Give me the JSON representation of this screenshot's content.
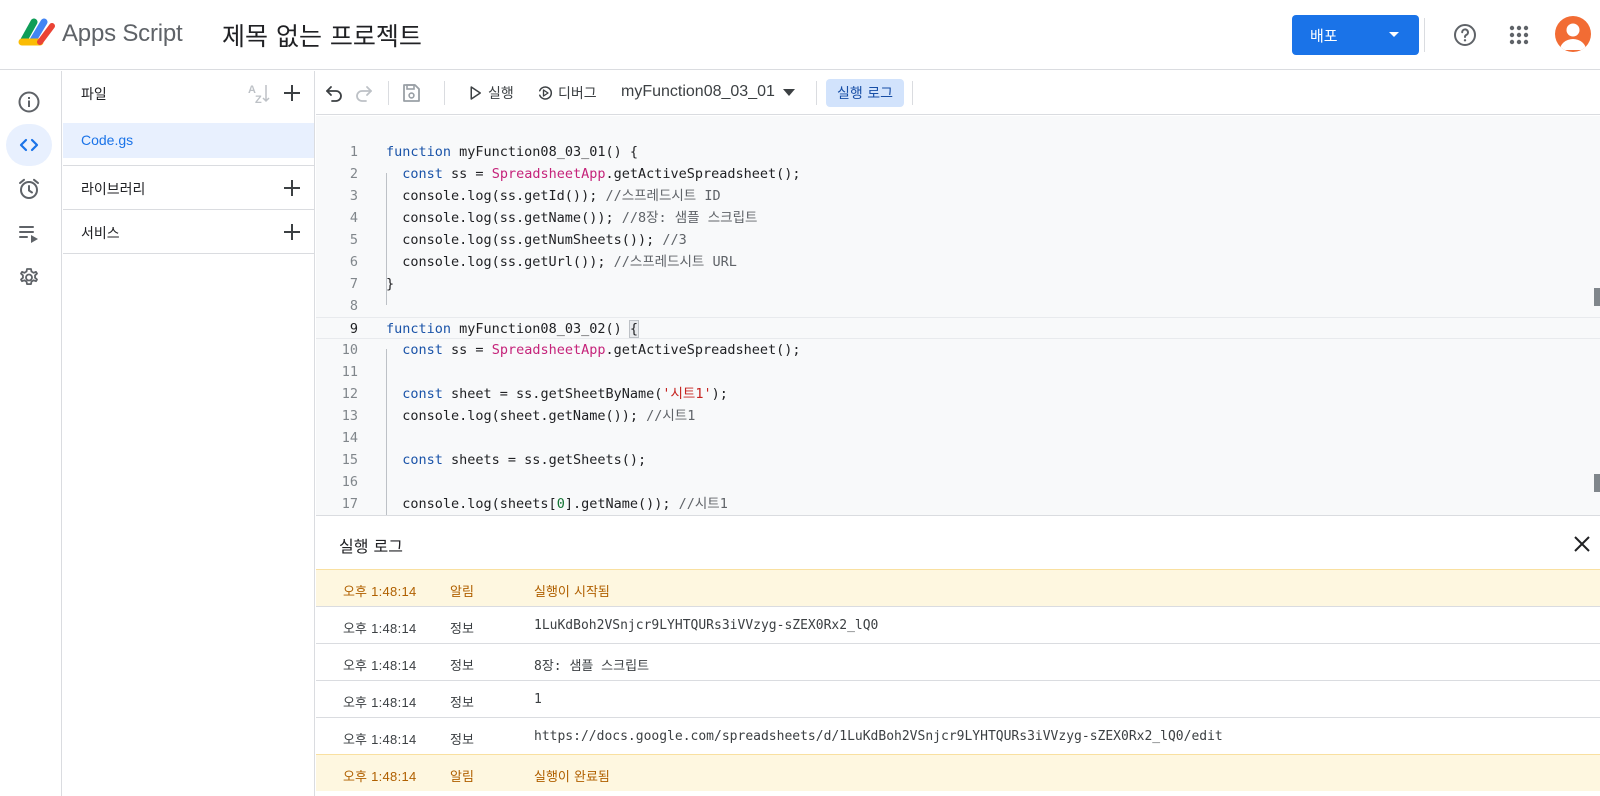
{
  "header": {
    "app_name": "Apps Script",
    "project_title": "제목 없는 프로젝트",
    "deploy_label": "배포",
    "avatar_color": "#f26c34",
    "accent": "#1a73e8"
  },
  "rail": {
    "items": [
      {
        "icon": "info-icon"
      },
      {
        "icon": "code-icon",
        "active": true
      },
      {
        "icon": "alarm-icon"
      },
      {
        "icon": "executions-icon"
      },
      {
        "icon": "gear-icon"
      }
    ]
  },
  "files_panel": {
    "files_label": "파일",
    "files": [
      "Code.gs"
    ],
    "libraries_label": "라이브러리",
    "services_label": "서비스"
  },
  "toolbar": {
    "run_label": "실행",
    "debug_label": "디버그",
    "function_selected": "myFunction08_03_01",
    "log_toggle_label": "실행 로그"
  },
  "editor": {
    "current_line": 9,
    "lines": [
      [
        {
          "t": "function",
          "c": "kw"
        },
        {
          "t": " myFunction08_03_01() {",
          "c": "p"
        }
      ],
      [
        {
          "t": "  ",
          "c": "p"
        },
        {
          "t": "const",
          "c": "kw"
        },
        {
          "t": " ss = ",
          "c": "p"
        },
        {
          "t": "SpreadsheetApp",
          "c": "cls"
        },
        {
          "t": ".getActiveSpreadsheet();",
          "c": "p"
        }
      ],
      [
        {
          "t": "  console.log(ss.getId()); ",
          "c": "p"
        },
        {
          "t": "//스프레드시트 ID",
          "c": "cm"
        }
      ],
      [
        {
          "t": "  console.log(ss.getName()); ",
          "c": "p"
        },
        {
          "t": "//8장: 샘플 스크립트",
          "c": "cm"
        }
      ],
      [
        {
          "t": "  console.log(ss.getNumSheets()); ",
          "c": "p"
        },
        {
          "t": "//3",
          "c": "cm"
        }
      ],
      [
        {
          "t": "  console.log(ss.getUrl()); ",
          "c": "p"
        },
        {
          "t": "//스프레드시트 URL",
          "c": "cm"
        }
      ],
      [
        {
          "t": "}",
          "c": "p"
        }
      ],
      [],
      [
        {
          "t": "function",
          "c": "kw"
        },
        {
          "t": " myFunction08_03_02() ",
          "c": "p"
        },
        {
          "t": "{",
          "c": "br"
        }
      ],
      [
        {
          "t": "  ",
          "c": "p"
        },
        {
          "t": "const",
          "c": "kw"
        },
        {
          "t": " ss = ",
          "c": "p"
        },
        {
          "t": "SpreadsheetApp",
          "c": "cls"
        },
        {
          "t": ".getActiveSpreadsheet();",
          "c": "p"
        }
      ],
      [],
      [
        {
          "t": "  ",
          "c": "p"
        },
        {
          "t": "const",
          "c": "kw"
        },
        {
          "t": " sheet = ss.getSheetByName(",
          "c": "p"
        },
        {
          "t": "'시트1'",
          "c": "str"
        },
        {
          "t": ");",
          "c": "p"
        }
      ],
      [
        {
          "t": "  console.log(sheet.getName()); ",
          "c": "p"
        },
        {
          "t": "//시트1",
          "c": "cm"
        }
      ],
      [],
      [
        {
          "t": "  ",
          "c": "p"
        },
        {
          "t": "const",
          "c": "kw"
        },
        {
          "t": " sheets = ss.getSheets();",
          "c": "p"
        }
      ],
      [],
      [
        {
          "t": "  console.log(sheets[",
          "c": "p"
        },
        {
          "t": "0",
          "c": "num"
        },
        {
          "t": "].getName()); ",
          "c": "p"
        },
        {
          "t": "//시트1",
          "c": "cm"
        }
      ]
    ],
    "colors": {
      "kw": "#1a53a8",
      "cls": "#c5237a",
      "cm": "#5f6368",
      "str": "#c5221f",
      "num": "#137333",
      "p": "#202124",
      "br": "#202124"
    }
  },
  "log": {
    "title": "실행 로그",
    "rows": [
      {
        "period": "오후",
        "clock": "1:48:14",
        "level": "알림",
        "msg": "실행이 시작됨",
        "type": "notice"
      },
      {
        "period": "오후",
        "clock": "1:48:14",
        "level": "정보",
        "msg": "1LuKdBoh2VSnjcr9LYHTQURs3iVVzyg-sZEX0Rx2_lQ0",
        "type": "info"
      },
      {
        "period": "오후",
        "clock": "1:48:14",
        "level": "정보",
        "msg": "8장: 샘플 스크립트",
        "type": "info"
      },
      {
        "period": "오후",
        "clock": "1:48:14",
        "level": "정보",
        "msg": "1",
        "type": "info"
      },
      {
        "period": "오후",
        "clock": "1:48:14",
        "level": "정보",
        "msg": "https://docs.google.com/spreadsheets/d/1LuKdBoh2VSnjcr9LYHTQURs3iVVzyg-sZEX0Rx2_lQ0/edit",
        "type": "info"
      },
      {
        "period": "오후",
        "clock": "1:48:14",
        "level": "알림",
        "msg": "실행이 완료됨",
        "type": "notice"
      }
    ]
  }
}
